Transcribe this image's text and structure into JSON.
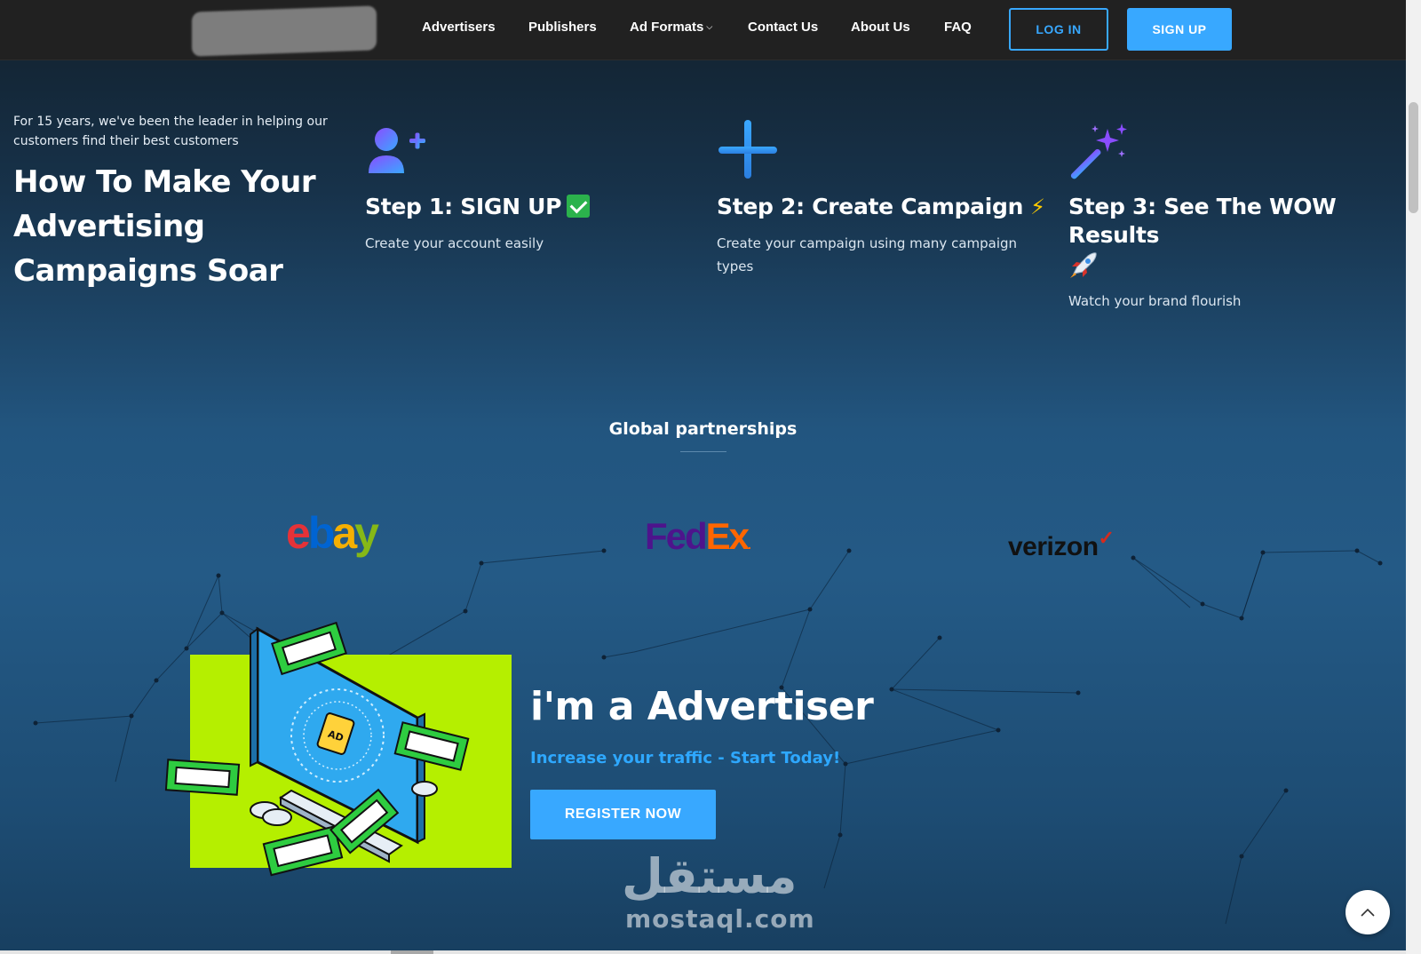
{
  "header": {
    "nav": [
      {
        "label": "Advertisers"
      },
      {
        "label": "Publishers"
      },
      {
        "label": "Ad Formats",
        "has_dropdown": true
      },
      {
        "label": "Contact Us"
      },
      {
        "label": "About Us"
      },
      {
        "label": "FAQ"
      }
    ],
    "login_label": "LOG IN",
    "signup_label": "SIGN UP"
  },
  "intro": {
    "subtitle": "For 15 years, we've been the leader in helping our customers find their best customers",
    "title": "How To Make Your Advertising Campaigns Soar"
  },
  "steps": [
    {
      "icon": "add-user-icon",
      "title": "Step 1: SIGN UP",
      "emoji": "check-mark-emoji",
      "description": "Create your account easily"
    },
    {
      "icon": "plus-icon",
      "title": "Step 2: Create Campaign",
      "emoji": "lightning-emoji",
      "description": "Create your campaign using many campaign types"
    },
    {
      "icon": "magic-wand-icon",
      "title": "Step 3: See The WOW Results",
      "emoji": "rocket-emoji",
      "description": "Watch your brand flourish"
    }
  ],
  "partners": {
    "title": "Global partnerships",
    "logos": [
      {
        "name": "ebay",
        "parts": [
          "e",
          "b",
          "a",
          "y"
        ]
      },
      {
        "name": "FedEx",
        "parts": [
          "Fed",
          "Ex",
          "."
        ]
      },
      {
        "name": "verizon",
        "parts": [
          "verizon",
          "✓"
        ]
      }
    ]
  },
  "advertiser": {
    "title": "i'm a Advertiser",
    "subtitle": "Increase your traffic - Start Today!",
    "button_label": "REGISTER NOW",
    "illustration_label": "AD"
  },
  "watermark": {
    "arabic": "مستقل",
    "latin": "mostaql.com"
  },
  "colors": {
    "accent": "#38a8ff",
    "card_green": "#b5ef00",
    "header_bg": "#212121"
  }
}
